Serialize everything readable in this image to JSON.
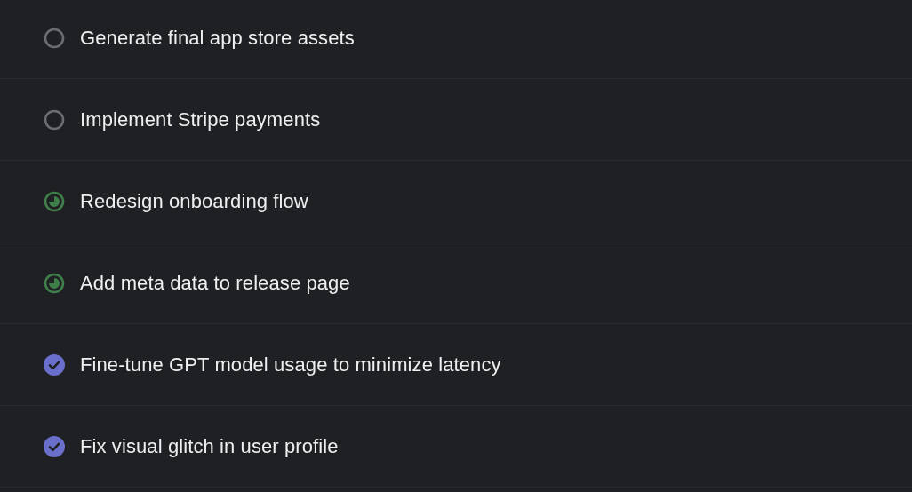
{
  "tasks": [
    {
      "title": "Generate final app store assets",
      "kind": "todo"
    },
    {
      "title": "Implement Stripe payments",
      "kind": "todo"
    },
    {
      "title": "Redesign onboarding flow",
      "kind": "started"
    },
    {
      "title": "Add meta data to release page",
      "kind": "started"
    },
    {
      "title": "Fine-tune GPT model usage to minimize latency",
      "kind": "done"
    },
    {
      "title": "Fix visual glitch in user profile",
      "kind": "done"
    }
  ]
}
